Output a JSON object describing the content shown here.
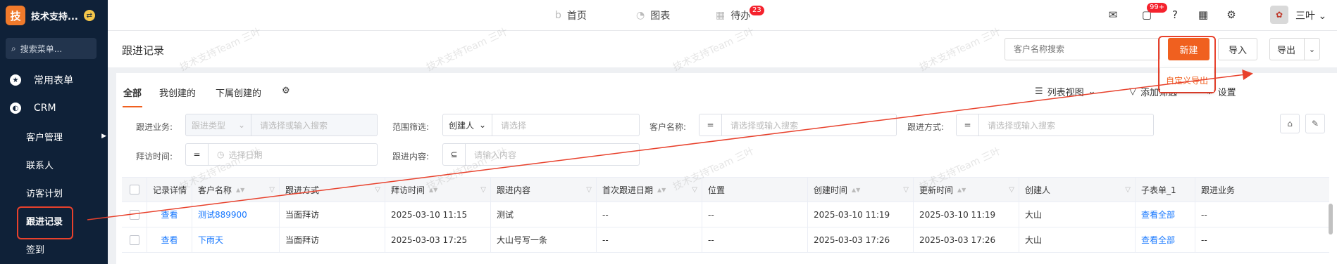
{
  "sidebar": {
    "brand_initial": "技",
    "brand_name": "技术支持...",
    "search_placeholder": "搜索菜单...",
    "items": [
      {
        "label": "常用表单",
        "icon": "star-icon"
      },
      {
        "label": "CRM",
        "icon": "crm-icon"
      }
    ],
    "sub_items": [
      "客户管理",
      "联系人",
      "访客计划",
      "跟进记录",
      "签到"
    ],
    "active_item": "跟进记录"
  },
  "topbar": {
    "tabs": [
      {
        "label": "首页",
        "icon": "home-icon"
      },
      {
        "label": "图表",
        "icon": "chart-icon"
      },
      {
        "label": "待办",
        "icon": "calendar-icon",
        "badge": "23"
      }
    ],
    "message_badge": "99+",
    "user_name": "三叶"
  },
  "header": {
    "title": "跟进记录",
    "search_placeholder": "客户名称搜索",
    "new_label": "新建",
    "import_label": "导入",
    "export_label": "导出",
    "export_menu": [
      "自定义导出"
    ]
  },
  "tabs": [
    "全部",
    "我创建的",
    "下属创建的"
  ],
  "toolbar": {
    "view_label": "列表视图",
    "filter_label": "添加筛选",
    "settings_label": "设置"
  },
  "filters": {
    "followup_business": {
      "label": "跟进业务:",
      "type": "跟进类型",
      "placeholder": "请选择或输入搜索"
    },
    "scope": {
      "label": "范围筛选:",
      "value": "创建人",
      "placeholder": "请选择"
    },
    "customer_name": {
      "label": "客户名称:",
      "op": "=",
      "placeholder": "请选择或输入搜索"
    },
    "followup_method": {
      "label": "跟进方式:",
      "op": "=",
      "placeholder": "请选择或输入搜索"
    },
    "visit_time": {
      "label": "拜访时间:",
      "op": "=",
      "placeholder": "选择日期"
    },
    "followup_content": {
      "label": "跟进内容:",
      "op": "⊆",
      "placeholder": "请输入内容"
    }
  },
  "table": {
    "columns": [
      "记录详情",
      "客户名称",
      "跟进方式",
      "拜访时间",
      "跟进内容",
      "首次跟进日期",
      "位置",
      "创建时间",
      "更新时间",
      "创建人",
      "子表单_1",
      "跟进业务"
    ],
    "rows": [
      [
        "查看",
        "测试889900",
        "当面拜访",
        "2025-03-10 11:15",
        "测试",
        "--",
        "--",
        "2025-03-10 11:19",
        "2025-03-10 11:19",
        "大山",
        "查看全部",
        "--"
      ],
      [
        "查看",
        "下雨天",
        "当面拜访",
        "2025-03-03 17:25",
        "大山号写一条",
        "--",
        "--",
        "2025-03-03 17:26",
        "2025-03-03 17:26",
        "大山",
        "查看全部",
        "--"
      ]
    ]
  },
  "watermark_text": "技术支持Team 三叶",
  "colors": {
    "sidebar": "#0f2138",
    "accent": "#f0601f",
    "annotation": "#e8412c",
    "link": "#1677ff"
  }
}
